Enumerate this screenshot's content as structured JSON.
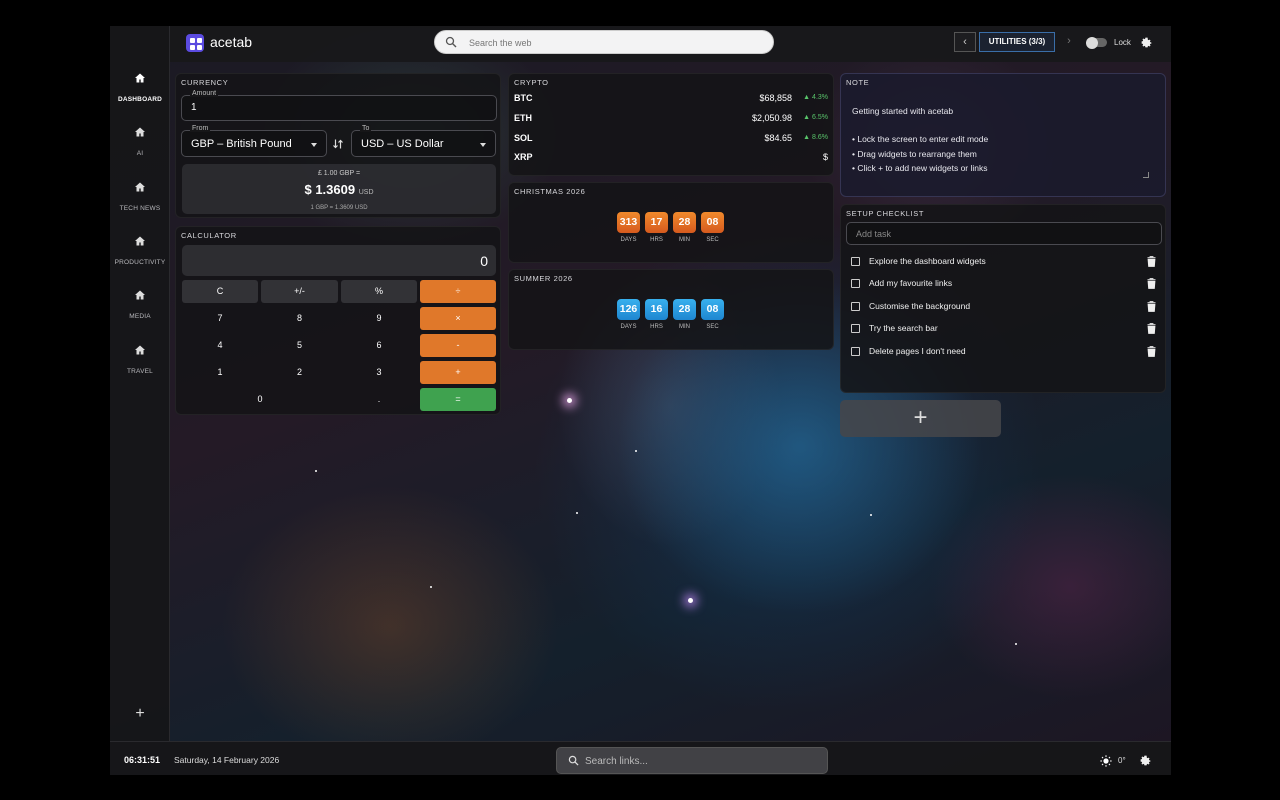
{
  "app": {
    "name": "acetab",
    "accent": "#5b4be0"
  },
  "search": {
    "placeholder": "Search the web"
  },
  "pager": {
    "label": "UTILITIES (3/3)",
    "prev": "‹",
    "next": "›"
  },
  "lock": {
    "label": "Lock",
    "enabled": false
  },
  "sidebar": {
    "items": [
      {
        "label": "DASHBOARD",
        "icon": "home-icon",
        "active": true
      },
      {
        "label": "AI",
        "icon": "home-icon"
      },
      {
        "label": "TECH NEWS",
        "icon": "home-icon"
      },
      {
        "label": "PRODUCTIVITY",
        "icon": "home-icon"
      },
      {
        "label": "MEDIA",
        "icon": "home-icon"
      },
      {
        "label": "TRAVEL",
        "icon": "home-icon"
      }
    ],
    "add_label": "+"
  },
  "currency": {
    "title": "CURRENCY",
    "amount_label": "Amount",
    "amount_value": "1",
    "from_label": "From",
    "from_value": "GBP – British Pound",
    "to_label": "To",
    "to_value": "USD – US Dollar",
    "line1": "£ 1.00 GBP =",
    "result": "$ 1.3609",
    "result_unit": "USD",
    "rate_line": "1 GBP = 1.3609 USD"
  },
  "calculator": {
    "title": "CALCULATOR",
    "display": "0",
    "keys": [
      [
        "C",
        "+/-",
        "%",
        "÷"
      ],
      [
        "7",
        "8",
        "9",
        "×"
      ],
      [
        "4",
        "5",
        "6",
        "-"
      ],
      [
        "1",
        "2",
        "3",
        "+"
      ],
      [
        "0",
        ".",
        "="
      ]
    ]
  },
  "crypto": {
    "title": "CRYPTO",
    "rows": [
      {
        "symbol": "BTC",
        "price": "$68,858",
        "change": "▲ 4.3%"
      },
      {
        "symbol": "ETH",
        "price": "$2,050.98",
        "change": "▲ 6.5%"
      },
      {
        "symbol": "SOL",
        "price": "$84.65",
        "change": "▲ 8.6%"
      },
      {
        "symbol": "XRP",
        "price": "$",
        "change": ""
      }
    ],
    "up_color": "#58c46a"
  },
  "countdowns": [
    {
      "title": "CHRISTMAS 2026",
      "days": "313",
      "hrs": "17",
      "min": "28",
      "sec": "08",
      "color": "#e0782a"
    },
    {
      "title": "SUMMER 2026",
      "days": "126",
      "hrs": "16",
      "min": "28",
      "sec": "08",
      "color": "#2a9ae0"
    }
  ],
  "countdown_units": {
    "days": "DAYS",
    "hrs": "HRS",
    "min": "MIN",
    "sec": "SEC"
  },
  "note": {
    "title": "NOTE",
    "text": "Getting started with acetab\n\n• Lock the screen to enter edit mode\n• Drag widgets to rearrange them\n• Click + to add new widgets or links"
  },
  "checklist": {
    "title": "SETUP CHECKLIST",
    "placeholder": "Add task",
    "tasks": [
      "Explore the dashboard widgets",
      "Add my favourite links",
      "Customise the background",
      "Try the search bar",
      "Delete pages I don't need"
    ]
  },
  "add_widget_label": "+",
  "bottom": {
    "time": "06:31:51",
    "date": "Saturday, 14 February 2026",
    "links_placeholder": "Search links...",
    "temperature": "0°"
  }
}
